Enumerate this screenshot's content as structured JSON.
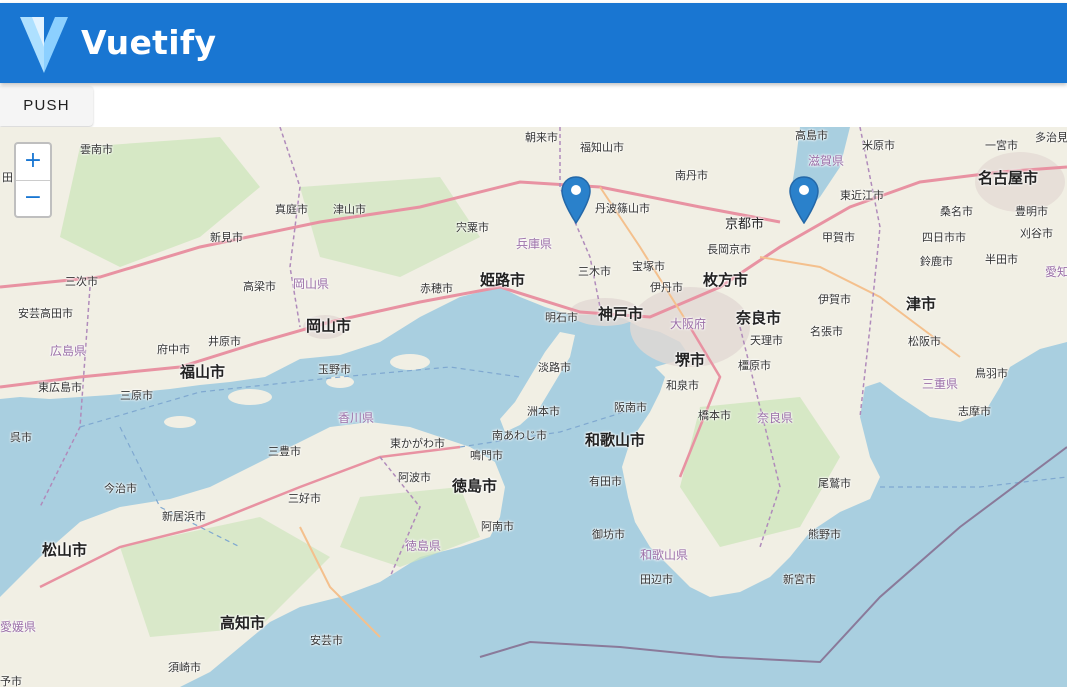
{
  "app_bar": {
    "title": "Vuetify",
    "logo_icon": "vuetify-logo",
    "color": "#1976d2"
  },
  "toolbar": {
    "push_label": "PUSH"
  },
  "map": {
    "zoom_in_label": "+",
    "zoom_out_label": "−",
    "markers": [
      {
        "name": "marker-1",
        "icon": "map-pin-icon",
        "color": "#2a81cb"
      },
      {
        "name": "marker-2",
        "icon": "map-pin-icon",
        "color": "#2a81cb"
      }
    ],
    "labels": [
      "朝来市",
      "福知山市",
      "南丹市",
      "高島市",
      "米原市",
      "多治見",
      "雲南市",
      "田",
      "丹波篠山市",
      "滋賀県",
      "東近江市",
      "一宮市",
      "名古屋市",
      "真庭市",
      "津山市",
      "宍粟市",
      "京都市",
      "桑名市",
      "豊明市",
      "新見市",
      "兵庫県",
      "長岡京市",
      "甲賀市",
      "四日市市",
      "刈谷市",
      "三次市",
      "高梁市",
      "岡山県",
      "赤穂市",
      "姫路市",
      "三木市",
      "宝塚市",
      "枚方市",
      "鈴鹿市",
      "半田市",
      "愛知",
      "伊丹市",
      "伊賀市",
      "津市",
      "安芸高田市",
      "明石市",
      "神戸市",
      "奈良市",
      "岡山市",
      "大阪府",
      "名張市",
      "広島県",
      "府中市",
      "井原市",
      "天理市",
      "松阪市",
      "淡路市",
      "堺市",
      "橿原市",
      "福山市",
      "玉野市",
      "鳥羽市",
      "東広島市",
      "三原市",
      "和泉市",
      "三重県",
      "洲本市",
      "阪南市",
      "橋本市",
      "奈良県",
      "志摩市",
      "香川県",
      "呉市",
      "東かがわ市",
      "南あわじ市",
      "和歌山市",
      "三豊市",
      "鳴門市",
      "阿波市",
      "徳島市",
      "有田市",
      "尾鷲市",
      "今治市",
      "三好市",
      "新居浜市",
      "阿南市",
      "御坊市",
      "熊野市",
      "松山市",
      "徳島県",
      "和歌山県",
      "田辺市",
      "新宮市",
      "愛媛県",
      "高知市",
      "安芸市",
      "須崎市",
      "予市"
    ]
  }
}
